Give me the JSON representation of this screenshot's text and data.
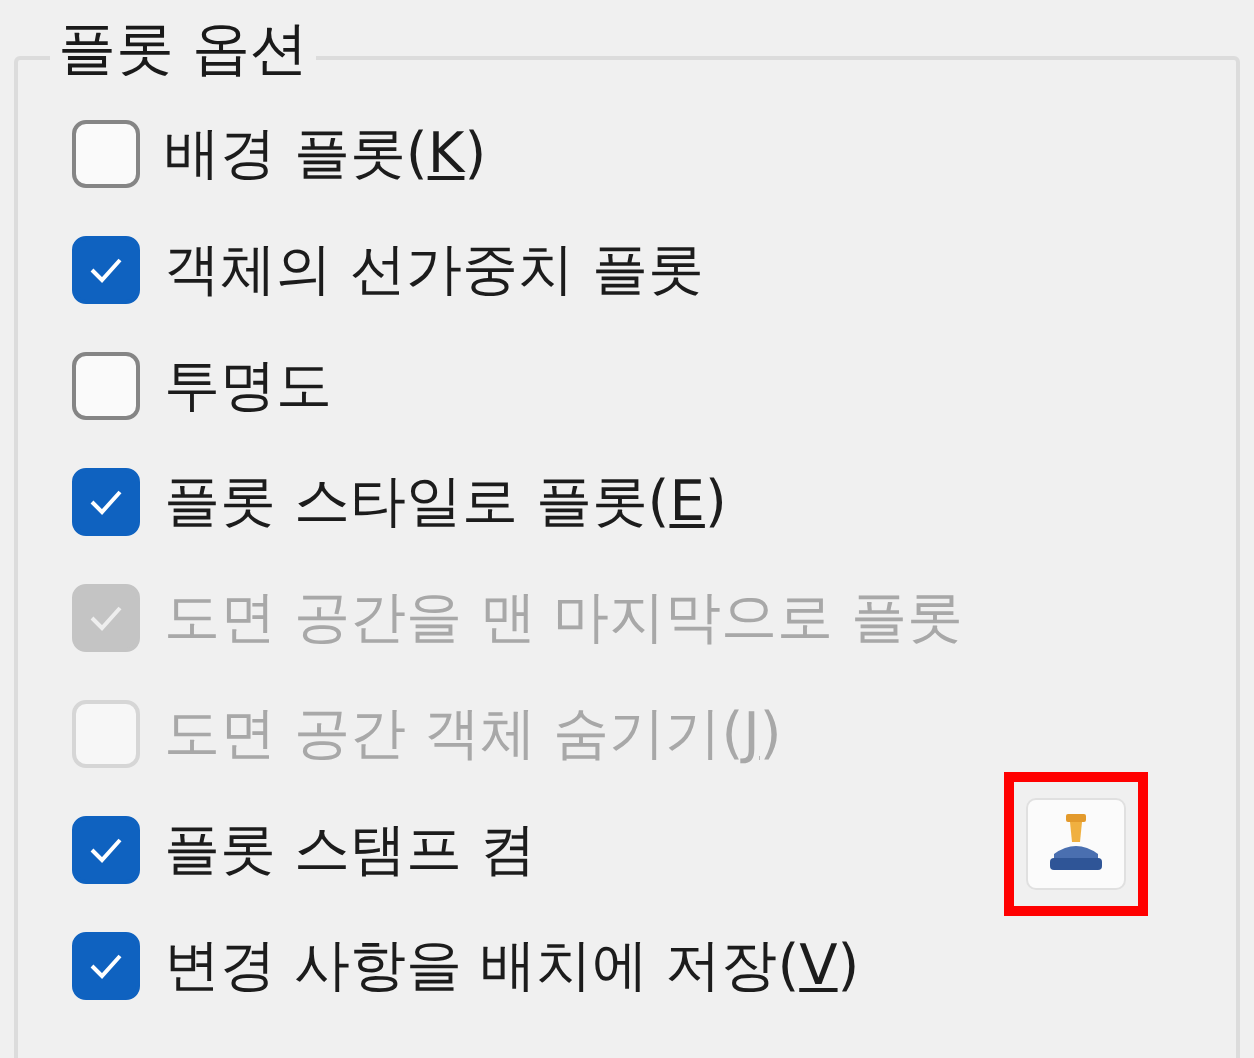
{
  "group": {
    "title": "플롯 옵션"
  },
  "options": [
    {
      "label": "배경 플롯(",
      "access_key": "K",
      "label_end": ")",
      "checked": false,
      "disabled": false
    },
    {
      "label": "객체의 선가중치 플롯",
      "checked": true,
      "disabled": false
    },
    {
      "label": "투명도",
      "checked": false,
      "disabled": false
    },
    {
      "label": "플롯 스타일로 플롯(",
      "access_key": "E",
      "label_end": ")",
      "checked": true,
      "disabled": false
    },
    {
      "label": "도면 공간을 맨 마지막으로 플롯",
      "checked": true,
      "disabled": true
    },
    {
      "label": "도면 공간 객체 숨기기(",
      "access_key": "J",
      "label_end": ")",
      "checked": false,
      "disabled": true
    },
    {
      "label": "플롯 스탬프 켬",
      "checked": true,
      "disabled": false,
      "stamp_button": {
        "highlighted": true
      }
    },
    {
      "label": "변경 사항을 배치에 저장(",
      "access_key": "V",
      "label_end": ")",
      "checked": true,
      "disabled": false
    }
  ]
}
